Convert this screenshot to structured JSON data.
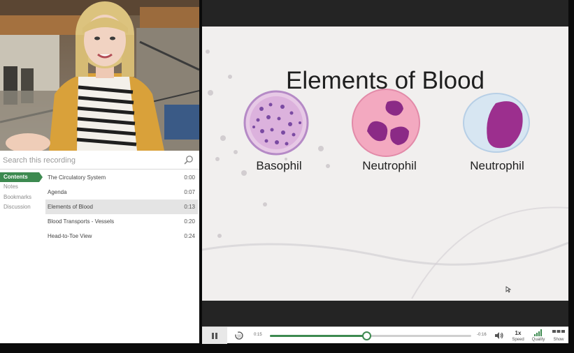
{
  "search": {
    "placeholder": "Search this recording"
  },
  "nav": {
    "items": [
      {
        "label": "Contents",
        "active": true
      },
      {
        "label": "Notes"
      },
      {
        "label": "Bookmarks"
      },
      {
        "label": "Discussion"
      }
    ]
  },
  "chapters": [
    {
      "title": "The Circulatory System",
      "time": "0:00"
    },
    {
      "title": "Agenda",
      "time": "0:07"
    },
    {
      "title": "Elements of Blood",
      "time": "0:13",
      "active": true
    },
    {
      "title": "Blood Transports - Vessels",
      "time": "0:20"
    },
    {
      "title": "Head-to-Toe View",
      "time": "0:24"
    }
  ],
  "slide": {
    "title": "Elements of Blood",
    "cells": [
      {
        "label": "Basophil"
      },
      {
        "label": "Neutrophil"
      },
      {
        "label": "Neutrophil"
      }
    ]
  },
  "player": {
    "elapsed": "0:15",
    "remaining": "-0:16",
    "progress_fraction": 0.48,
    "speed_value": "1x",
    "speed_label": "Speed",
    "quality_label": "Quality",
    "show_label": "Show"
  },
  "colors": {
    "accent": "#3d8a50",
    "active_row": "#e4e4e4"
  }
}
